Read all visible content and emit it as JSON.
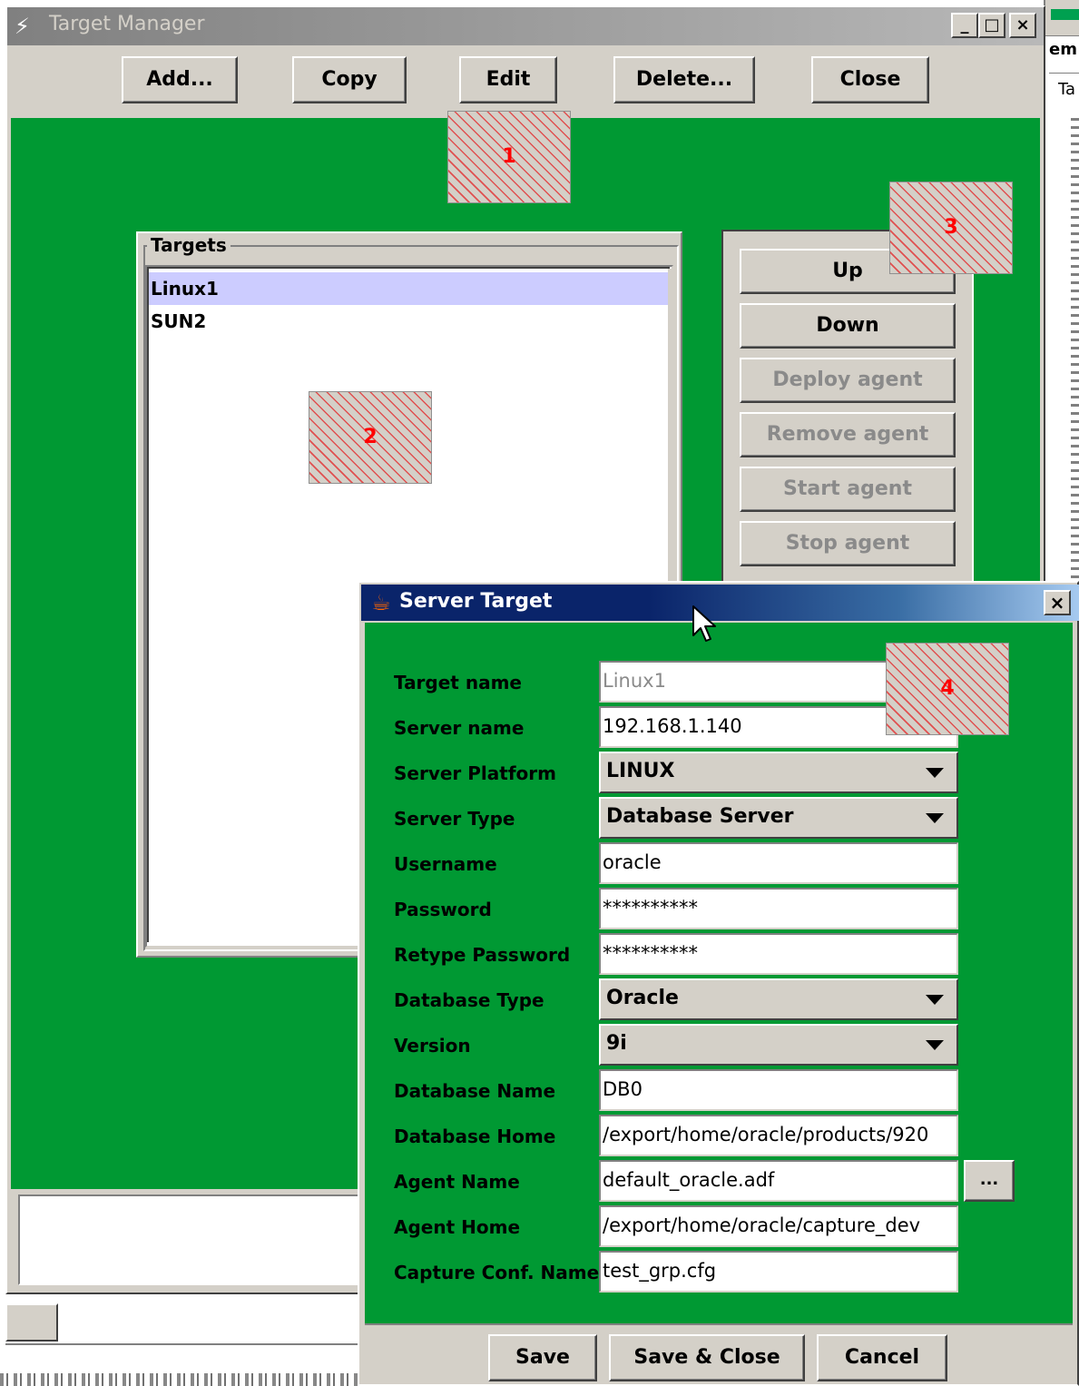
{
  "background_window": {
    "label_top": "em",
    "label_tab": "Ta"
  },
  "target_manager": {
    "title": "Target Manager",
    "window_controls": {
      "minimize": "_",
      "maximize": "□",
      "close": "×"
    },
    "toolbar": {
      "add": "Add...",
      "copy": "Copy",
      "edit": "Edit",
      "delete": "Delete...",
      "close": "Close"
    },
    "targets_group": {
      "legend": "Targets",
      "items": [
        "Linux1",
        "SUN2"
      ],
      "selected_index": 0
    },
    "agent_buttons": {
      "up": "Up",
      "down": "Down",
      "deploy": "Deploy agent",
      "remove": "Remove agent",
      "start": "Start agent",
      "stop": "Stop agent"
    }
  },
  "server_target": {
    "title": "Server Target",
    "close": "×",
    "fields": {
      "target_name": {
        "label": "Target name",
        "value": "Linux1"
      },
      "server_name": {
        "label": "Server name",
        "value": "192.168.1.140"
      },
      "server_platform": {
        "label": "Server Platform",
        "value": "LINUX"
      },
      "server_type": {
        "label": "Server Type",
        "value": "Database Server"
      },
      "username": {
        "label": "Username",
        "value": "oracle"
      },
      "password": {
        "label": "Password",
        "value": "**********"
      },
      "retype_password": {
        "label": "Retype Password",
        "value": "**********"
      },
      "database_type": {
        "label": "Database Type",
        "value": "Oracle"
      },
      "version": {
        "label": "Version",
        "value": "9i"
      },
      "database_name": {
        "label": "Database Name",
        "value": "DB0"
      },
      "database_home": {
        "label": "Database Home",
        "value": "/export/home/oracle/products/920"
      },
      "agent_name": {
        "label": "Agent Name",
        "value": "default_oracle.adf"
      },
      "agent_home": {
        "label": "Agent Home",
        "value": "/export/home/oracle/capture_dev"
      },
      "capture_conf_name": {
        "label": "Capture Conf. Name",
        "value": "test_grp.cfg"
      }
    },
    "browse_label": "...",
    "buttons": {
      "save": "Save",
      "save_close": "Save & Close",
      "cancel": "Cancel"
    }
  },
  "callouts": [
    "1",
    "2",
    "3",
    "4"
  ],
  "colors": {
    "panel_green": "#009933",
    "selection": "#ccccff",
    "dialog_title": "#0a246a",
    "callout_text": "#ff0000"
  }
}
